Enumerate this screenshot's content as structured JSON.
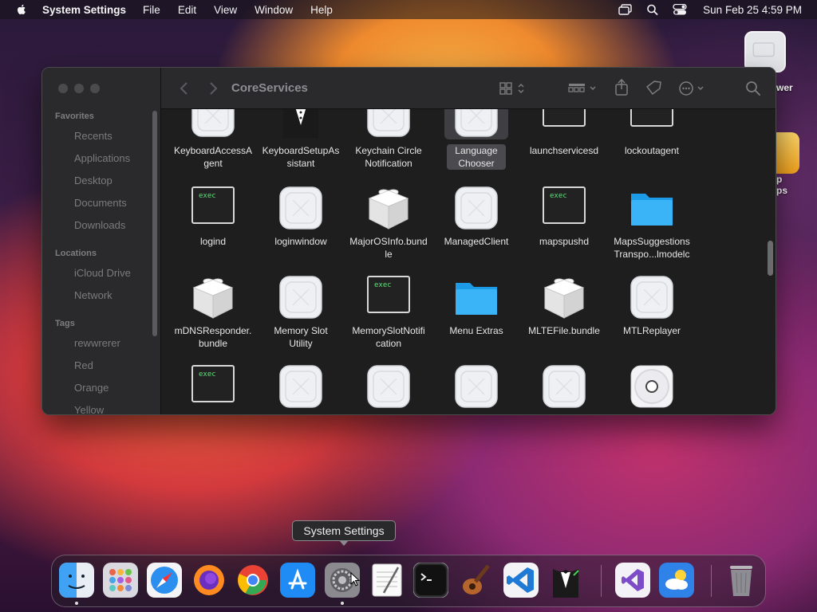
{
  "menubar": {
    "app_name": "System Settings",
    "menus": [
      "File",
      "Edit",
      "View",
      "Window",
      "Help"
    ],
    "datetime": "Sun Feb 25  4:59 PM"
  },
  "desktop": {
    "icons": [
      {
        "label": "wer"
      },
      {
        "label": "p\nps"
      }
    ]
  },
  "finder": {
    "title": "CoreServices",
    "sidebar": {
      "favorites_header": "Favorites",
      "favorites": [
        "Recents",
        "Applications",
        "Desktop",
        "Documents",
        "Downloads"
      ],
      "locations_header": "Locations",
      "locations": [
        "iCloud Drive",
        "Network"
      ],
      "tags_header": "Tags",
      "tags": [
        "rewwrerer",
        "Red",
        "Orange",
        "Yellow"
      ]
    },
    "exec_label": "exec",
    "items": [
      {
        "name": "KeyboardAccessAgent",
        "label": "KeyboardAccessA\ngent",
        "kind": "generic"
      },
      {
        "name": "KeyboardSetupAssistant",
        "label": "KeyboardSetupAs\nsistant",
        "kind": "tux"
      },
      {
        "name": "Keychain Circle Notification",
        "label": "Keychain Circle\nNotification",
        "kind": "generic"
      },
      {
        "name": "Language Chooser",
        "label": "Language\nChooser",
        "kind": "generic",
        "selected": true
      },
      {
        "name": "launchservicesd",
        "label": "launchservicesd",
        "kind": "exec-top"
      },
      {
        "name": "lockoutagent",
        "label": "lockoutagent",
        "kind": "exec-top"
      },
      {
        "name": "logind",
        "label": "logind",
        "kind": "exec"
      },
      {
        "name": "loginwindow",
        "label": "loginwindow",
        "kind": "generic"
      },
      {
        "name": "MajorOSInfo.bundle",
        "label": "MajorOSInfo.bund\nle",
        "kind": "bundle"
      },
      {
        "name": "ManagedClient",
        "label": "ManagedClient",
        "kind": "generic"
      },
      {
        "name": "mapspushd",
        "label": "mapspushd",
        "kind": "exec"
      },
      {
        "name": "MapsSuggestionsTransportModeModel",
        "label": "MapsSuggestions\nTranspo...lmodelc",
        "kind": "folder"
      },
      {
        "name": "mDNSResponder.bundle",
        "label": "mDNSResponder.\nbundle",
        "kind": "bundle"
      },
      {
        "name": "Memory Slot Utility",
        "label": "Memory Slot\nUtility",
        "kind": "generic"
      },
      {
        "name": "MemorySlotNotification",
        "label": "MemorySlotNotifi\ncation",
        "kind": "exec"
      },
      {
        "name": "Menu Extras",
        "label": "Menu Extras",
        "kind": "folder"
      },
      {
        "name": "MLTEFile.bundle",
        "label": "MLTEFile.bundle",
        "kind": "bundle"
      },
      {
        "name": "MTLReplayer",
        "label": "MTLReplayer",
        "kind": "generic"
      },
      {
        "name": "row4-exec",
        "label": "",
        "kind": "exec"
      },
      {
        "name": "row4-app-2",
        "label": "",
        "kind": "generic"
      },
      {
        "name": "row4-app-3",
        "label": "",
        "kind": "generic"
      },
      {
        "name": "row4-app-4",
        "label": "",
        "kind": "generic"
      },
      {
        "name": "row4-app-5",
        "label": "",
        "kind": "generic"
      },
      {
        "name": "row4-disc",
        "label": "",
        "kind": "disc"
      }
    ]
  },
  "tooltip": "System Settings",
  "dock": {
    "apps": [
      {
        "name": "finder",
        "color": "#3fa2f5",
        "running": true
      },
      {
        "name": "launchpad",
        "color": "#c9c9d0",
        "running": false
      },
      {
        "name": "safari",
        "color": "#2b8ff0",
        "running": false
      },
      {
        "name": "firefox",
        "color": "#ff8a1f",
        "running": false
      },
      {
        "name": "chrome",
        "color": "#f2f2f2",
        "running": false
      },
      {
        "name": "app-store",
        "color": "#1f8cf5",
        "running": false
      },
      {
        "name": "system-settings",
        "color": "#8a8a8f",
        "running": true
      },
      {
        "name": "textedit",
        "color": "#f4f4f4",
        "running": false
      },
      {
        "name": "terminal",
        "color": "#1b1b1b",
        "running": false
      },
      {
        "name": "instruments",
        "color": "#6b3a1d",
        "running": false
      },
      {
        "name": "vscode",
        "color": "#1f7ad6",
        "running": false
      },
      {
        "name": "tux-app",
        "color": "#2e2e2e",
        "running": false
      },
      {
        "name": "visual-studio",
        "color": "#f3f3f7",
        "running": false
      },
      {
        "name": "weather",
        "color": "#2f83e8",
        "running": false
      },
      {
        "name": "trash",
        "color": "#9a9aa0",
        "running": false
      }
    ]
  }
}
